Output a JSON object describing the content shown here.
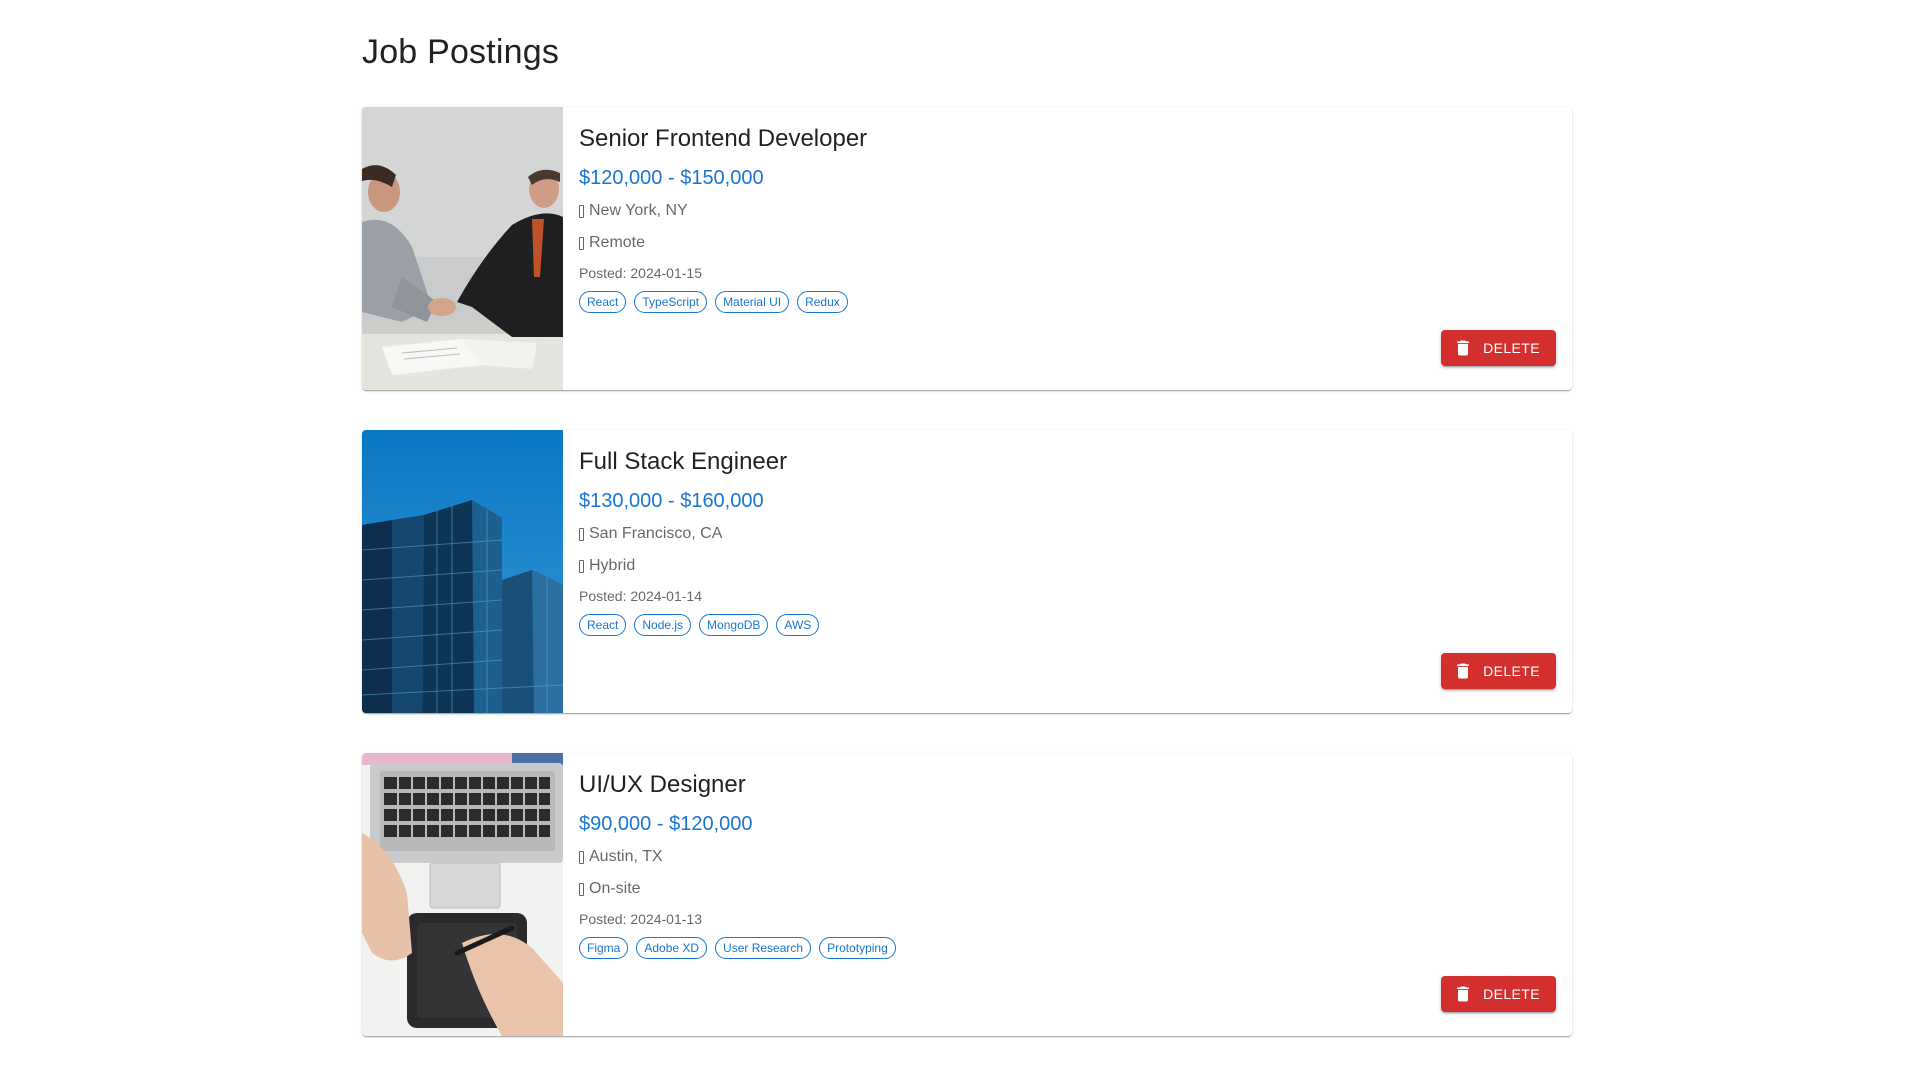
{
  "page": {
    "title": "Job Postings"
  },
  "jobs": [
    {
      "title": "Senior Frontend Developer",
      "salary": "$120,000 - $150,000",
      "location": "New York, NY",
      "work_type": "Remote",
      "posted": "Posted: 2024-01-15",
      "tags": [
        "React",
        "TypeScript",
        "Material UI",
        "Redux"
      ],
      "delete_label": "Delete",
      "image": "handshake-photo"
    },
    {
      "title": "Full Stack Engineer",
      "salary": "$130,000 - $160,000",
      "location": "San Francisco, CA",
      "work_type": "Hybrid",
      "posted": "Posted: 2024-01-14",
      "tags": [
        "React",
        "Node.js",
        "MongoDB",
        "AWS"
      ],
      "delete_label": "Delete",
      "image": "office-building-photo"
    },
    {
      "title": "UI/UX Designer",
      "salary": "$90,000 - $120,000",
      "location": "Austin, TX",
      "work_type": "On-site",
      "posted": "Posted: 2024-01-13",
      "tags": [
        "Figma",
        "Adobe XD",
        "User Research",
        "Prototyping"
      ],
      "delete_label": "Delete",
      "image": "laptop-drawing-tablet-photo"
    }
  ],
  "colors": {
    "primary": "#1976d2",
    "danger": "#d32f2f"
  }
}
